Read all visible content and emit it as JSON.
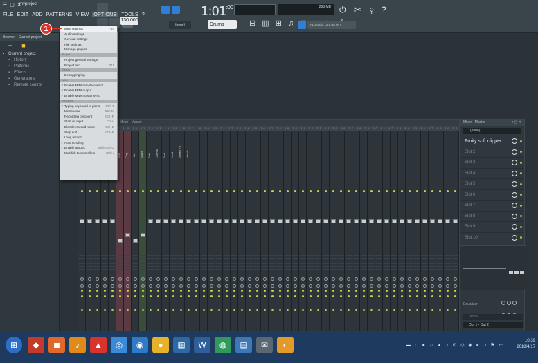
{
  "window": {
    "title": "myproject",
    "controls": "☰ ▢ ✕"
  },
  "menubar": {
    "items": [
      "FILE",
      "EDIT",
      "ADD",
      "PATTERNS",
      "VIEW",
      "OPTIONS",
      "TOOLS",
      "?"
    ],
    "active": "OPTIONS"
  },
  "toolbar": {
    "song_time": "1:01",
    "song_time_sub": ":00",
    "tempo": "130.000",
    "pattern_mode": "(none)",
    "pattern_name": "Drums",
    "cpu_text": "293 MB",
    "news": "FL Studio 12.9 BETA 4"
  },
  "browser": {
    "title": "Browser - Current project",
    "items": [
      {
        "label": "Current project",
        "level": 0,
        "icon": "folder-icon"
      },
      {
        "label": "History",
        "level": 1,
        "icon": "history-icon"
      },
      {
        "label": "Patterns",
        "level": 1,
        "icon": "pattern-icon"
      },
      {
        "label": "Effects",
        "level": 1,
        "icon": "effects-icon"
      },
      {
        "label": "Generators",
        "level": 1,
        "icon": "generator-icon"
      },
      {
        "label": "Remote control",
        "level": 1,
        "icon": "remote-icon"
      }
    ]
  },
  "options_menu": {
    "sections": [
      {
        "header": "",
        "items": [
          {
            "label": "MIDI settings",
            "shortcut": "F10",
            "highlight": true
          },
          {
            "label": "Audio settings",
            "shortcut": ""
          },
          {
            "label": "General settings",
            "shortcut": ""
          },
          {
            "label": "File settings",
            "shortcut": ""
          },
          {
            "label": "Manage plugins",
            "shortcut": ""
          }
        ]
      },
      {
        "header": "Project",
        "items": [
          {
            "label": "Project general settings",
            "shortcut": ""
          },
          {
            "label": "Project info",
            "shortcut": "F11"
          }
        ]
      },
      {
        "header": "Debug",
        "items": [
          {
            "label": "Debugging log",
            "shortcut": ""
          }
        ]
      },
      {
        "header": "MIDI",
        "items": [
          {
            "label": "Enable MIDI remote control",
            "shortcut": "",
            "check": true
          },
          {
            "label": "Enable MIDI output",
            "shortcut": "",
            "check": true
          },
          {
            "label": "Enable MIDI master sync",
            "shortcut": "",
            "check": true
          }
        ]
      },
      {
        "header": "Recording",
        "items": [
          {
            "label": "Typing keyboard to piano",
            "shortcut": "Ctrl+T",
            "check": true
          },
          {
            "label": "Metronome",
            "shortcut": "Ctrl+M"
          },
          {
            "label": "Recording precount",
            "shortcut": "Ctrl+P"
          },
          {
            "label": "Start on input",
            "shortcut": "Ctrl+I"
          },
          {
            "label": "Blend recorded notes",
            "shortcut": "Ctrl+B"
          },
          {
            "label": "Step edit",
            "shortcut": "Ctrl+E"
          },
          {
            "label": "Loop record",
            "shortcut": ""
          },
          {
            "label": "Auto scrolling",
            "shortcut": "",
            "check": true
          },
          {
            "label": "Enable groups",
            "shortcut": "Shift+Alt+G",
            "check": true
          },
          {
            "label": "Multilink to controllers",
            "shortcut": "Ctrl+J"
          }
        ]
      }
    ]
  },
  "annotation": {
    "number": "1"
  },
  "mixer": {
    "title": "Mixer - Master",
    "strip_names": [
      "Kick",
      "Clap",
      "Hat",
      "Snare",
      "Sub",
      "Chords",
      "Pad",
      "Lead",
      "Sweep FX",
      "Vocals"
    ],
    "inserts_title": "Mixer - Master",
    "input": "(none)",
    "slots": [
      "Fruity soft clipper",
      "Slot 2",
      "Slot 3",
      "Slot 4",
      "Slot 5",
      "Slot 6",
      "Slot 7",
      "Slot 8",
      "Slot 9",
      "Slot 10"
    ],
    "eq_label": "Equalizer",
    "in_label": "(none)",
    "output": "Out 1 - Out 2"
  },
  "taskbar": {
    "time": "10:39",
    "date": "2018/4/17"
  },
  "colors": {
    "accent": "#e0302b",
    "menu_bg": "#d8dcdf",
    "led": "#97d43c"
  }
}
